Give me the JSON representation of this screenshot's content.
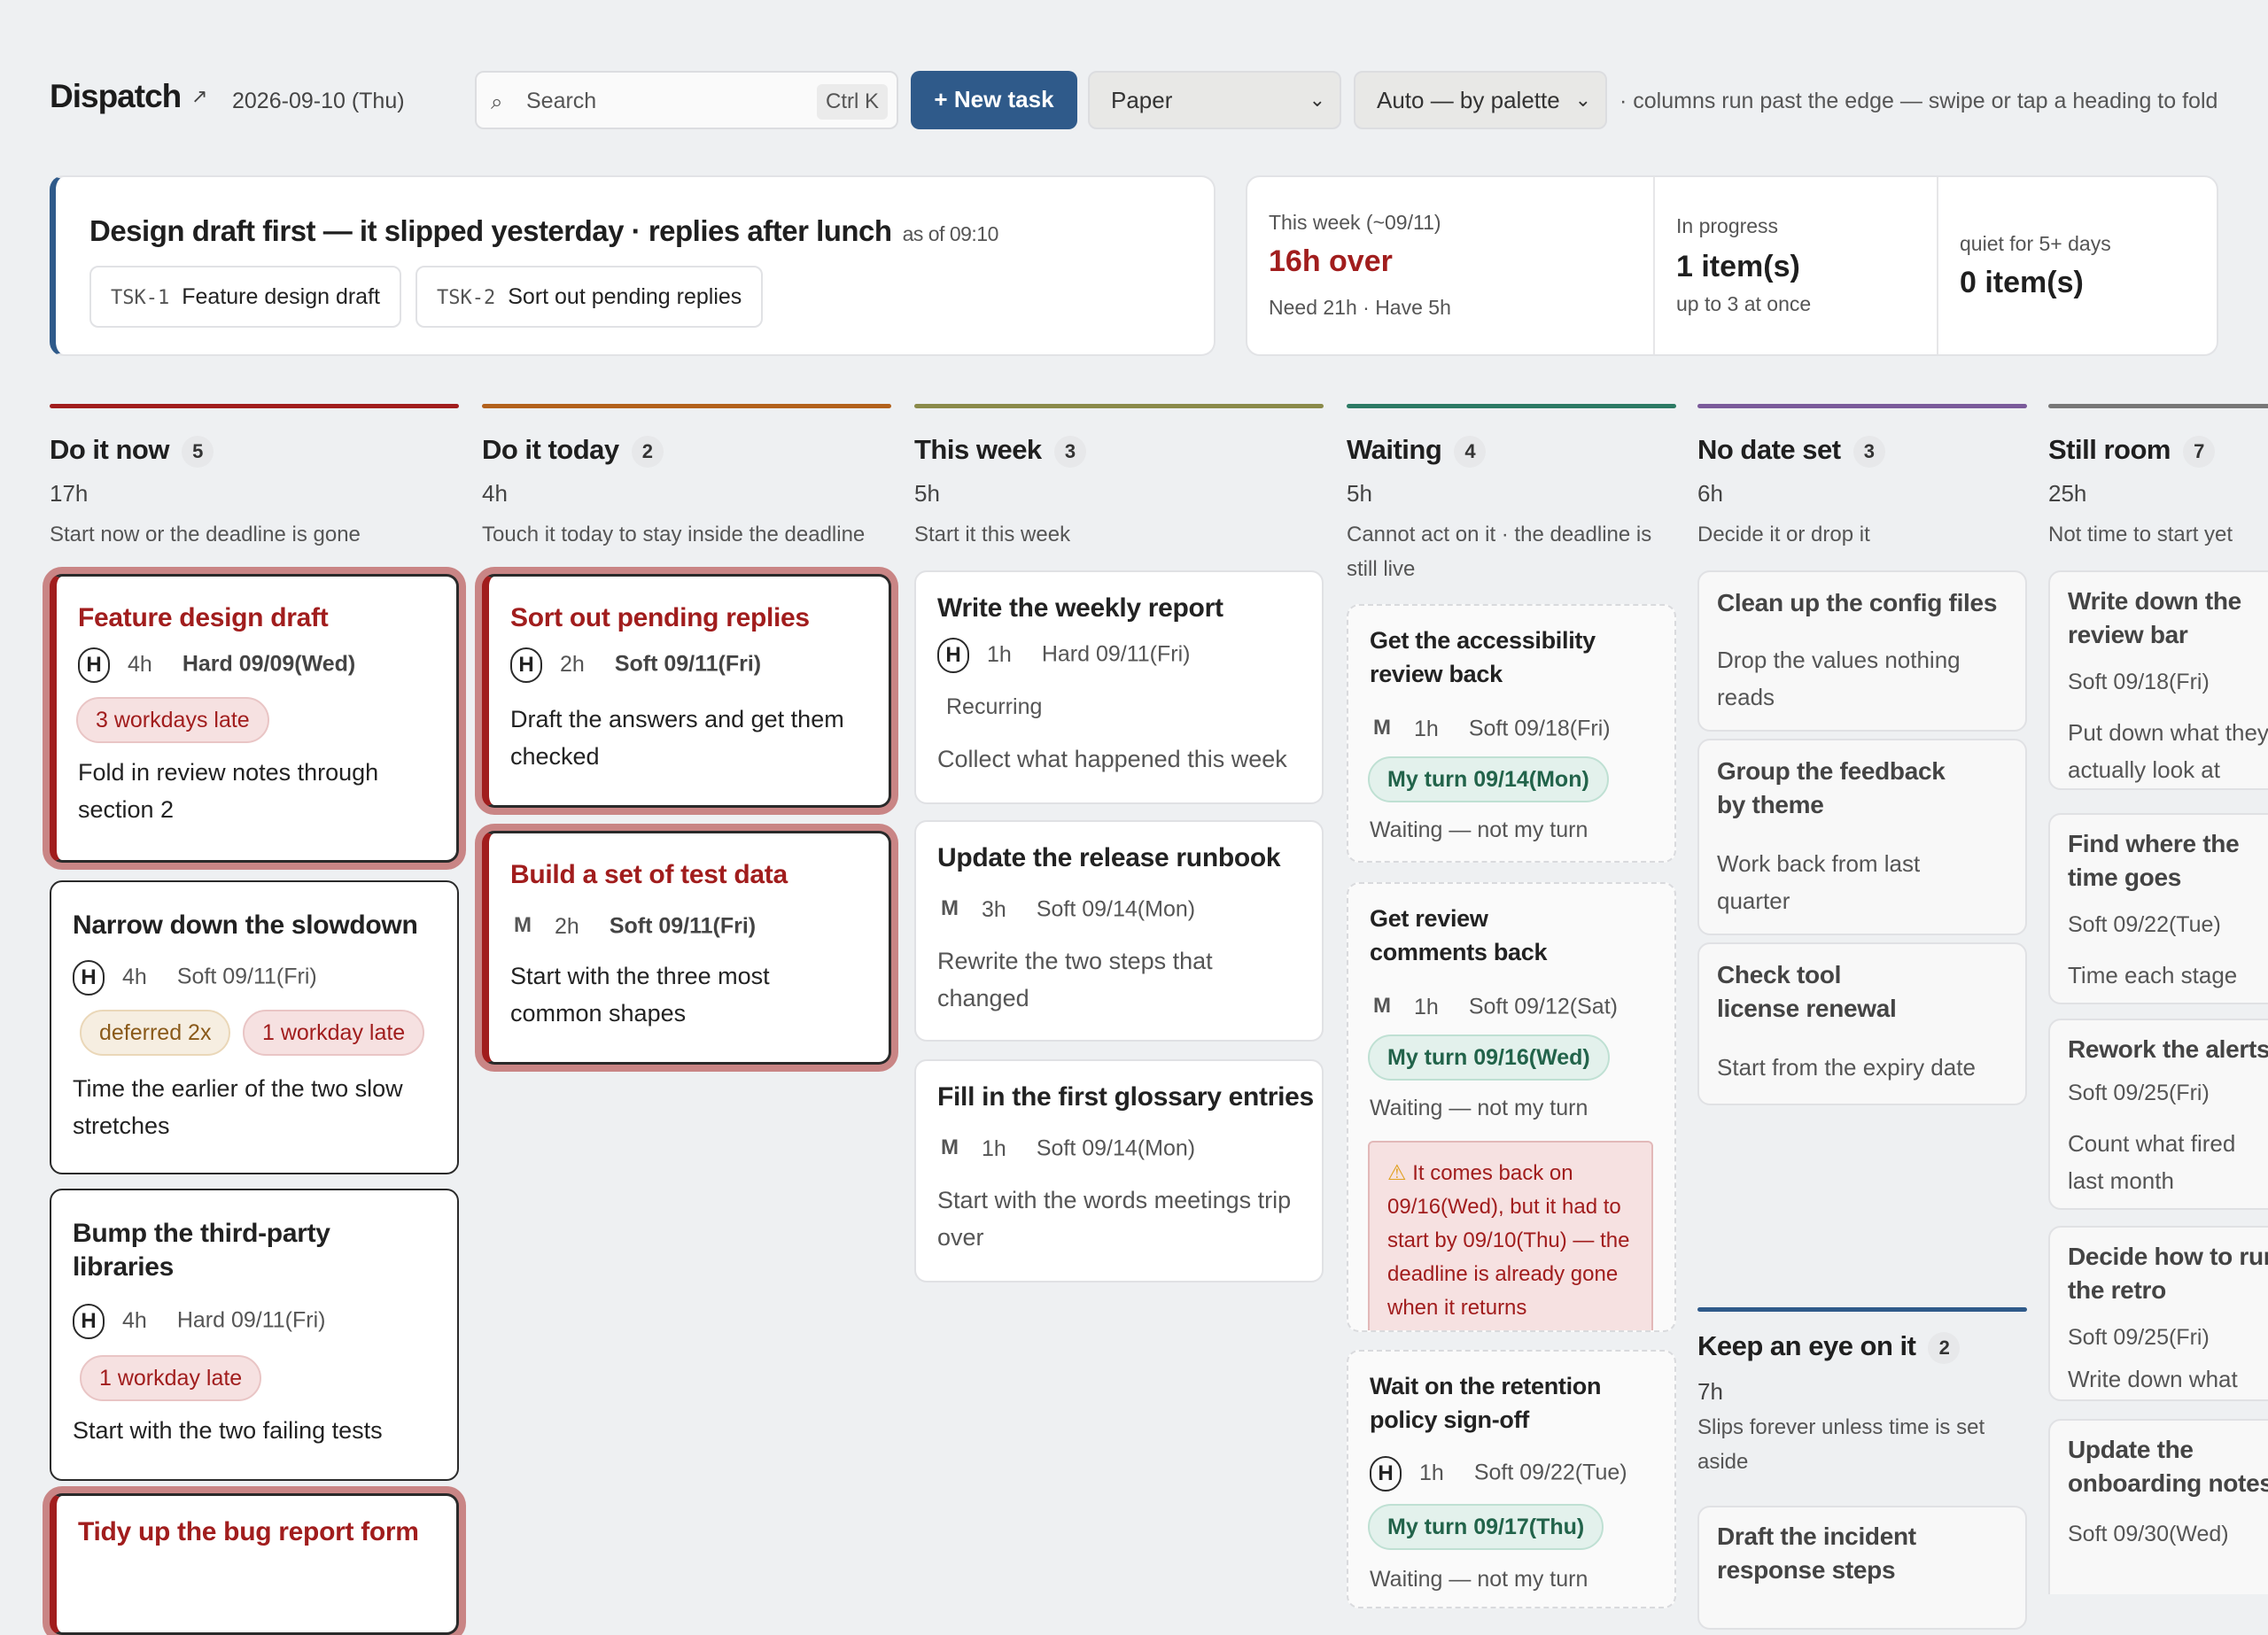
{
  "app": {
    "name": "Dispatch",
    "date": "2026-09-10 (Thu)"
  },
  "toolbar": {
    "search_placeholder": "Search",
    "search_shortcut": "Ctrl K",
    "new_task_label": "+ New task",
    "theme_selected": "Paper",
    "color_mode_selected": "Auto — by palette",
    "hint": "· columns run past the edge — swipe or tap a heading to fold"
  },
  "focus": {
    "title": "Design draft first — it slipped yesterday · replies after lunch",
    "as_of": "as of 09:10",
    "chips": [
      {
        "id": "TSK-1",
        "label": "Feature design draft"
      },
      {
        "id": "TSK-2",
        "label": "Sort out pending replies"
      }
    ]
  },
  "stats": [
    {
      "label": "This week (~09/11)",
      "value": "16h over",
      "sub": "Need 21h · Have 5h",
      "color": "#a11d1d"
    },
    {
      "label": "In progress",
      "value": "1 item(s)",
      "sub": "up to 3 at once"
    },
    {
      "label": "quiet for 5+ days",
      "value": "0 item(s)",
      "sub": ""
    }
  ],
  "columns": {
    "now": {
      "title": "Do it now",
      "count": "5",
      "hours": "17h",
      "desc": "Start now or the deadline is gone",
      "color": "#a11d1d",
      "cards": [
        {
          "title": "Feature design draft",
          "pri": "H",
          "hours": "4h",
          "deadline": "Hard 09/09(Wed)",
          "pills": [
            "3 workdays late"
          ],
          "note": "Fold in review notes through section 2"
        },
        {
          "title": "Narrow down the slowdown",
          "pri": "H",
          "hours": "4h",
          "deadline": "Soft 09/11(Fri)",
          "pills": [
            "deferred 2x",
            "1 workday late"
          ],
          "note": "Time the earlier of the two slow stretches"
        },
        {
          "title": "Bump the third-party libraries",
          "pri": "H",
          "hours": "4h",
          "deadline": "Hard 09/11(Fri)",
          "pills": [
            "1 workday late"
          ],
          "note": "Start with the two failing tests"
        },
        {
          "title": "Tidy up the bug report form",
          "pri": "",
          "hours": "",
          "deadline": "",
          "pills": [],
          "note": ""
        }
      ]
    },
    "today": {
      "title": "Do it today",
      "count": "2",
      "hours": "4h",
      "desc": "Touch it today to stay inside the deadline",
      "color": "#b2611c",
      "cards": [
        {
          "title": "Sort out pending replies",
          "pri": "H",
          "hours": "2h",
          "deadline": "Soft 09/11(Fri)",
          "note": "Draft the answers and get them checked"
        },
        {
          "title": "Build a set of test data",
          "pri": "M",
          "hours": "2h",
          "deadline": "Soft 09/11(Fri)",
          "note": "Start with the three most common shapes"
        }
      ]
    },
    "week": {
      "title": "This week",
      "count": "3",
      "hours": "5h",
      "desc": "Start it this week",
      "color": "#8a8a4a",
      "cards": [
        {
          "title": "Write the weekly report",
          "pri": "H",
          "hours": "1h",
          "deadline": "Hard 09/11(Fri)",
          "tag": "Recurring",
          "note": "Collect what happened this week"
        },
        {
          "title": "Update the release runbook",
          "pri": "M",
          "hours": "3h",
          "deadline": "Soft 09/14(Mon)",
          "note": "Rewrite the two steps that changed"
        },
        {
          "title": "Fill in the first glossary entries",
          "pri": "M",
          "hours": "1h",
          "deadline": "Soft 09/14(Mon)",
          "note": "Start with the words meetings trip over"
        }
      ]
    },
    "waiting": {
      "title": "Waiting",
      "count": "4",
      "hours": "5h",
      "desc": "Cannot act on it · the deadline is still live",
      "color": "#2c7a64",
      "cards": [
        {
          "title": "Get the accessibility review back",
          "pri": "M",
          "hours": "1h",
          "deadline": "Soft 09/18(Fri)",
          "turn": "My turn 09/14(Mon)",
          "note": "Waiting — not my turn"
        },
        {
          "title": "Get review comments back",
          "pri": "M",
          "hours": "1h",
          "deadline": "Soft 09/12(Sat)",
          "turn": "My turn 09/16(Wed)",
          "note": "Waiting — not my turn",
          "warning": "It comes back on 09/16(Wed), but it had to start by 09/10(Thu) — the deadline is already gone when it returns"
        },
        {
          "title": "Wait on the retention policy sign-off",
          "pri": "H",
          "hours": "1h",
          "deadline": "Soft 09/22(Tue)",
          "turn": "My turn 09/17(Thu)",
          "note": "Waiting — not my turn"
        }
      ]
    },
    "nodate": {
      "title": "No date set",
      "count": "3",
      "hours": "6h",
      "desc": "Decide it or drop it",
      "color": "#7a5a9a",
      "cards": [
        {
          "title": "Clean up the config files",
          "note": "Drop the values nothing reads"
        },
        {
          "title": "Group the feedback by theme",
          "note": "Work back from last quarter"
        },
        {
          "title": "Check tool license renewal",
          "note": "Start from the expiry date"
        }
      ]
    },
    "eye": {
      "title": "Keep an eye on it",
      "count": "2",
      "hours": "7h",
      "desc": "Slips forever unless time is set aside",
      "color": "#2f5a8a",
      "cards": [
        {
          "title": "Draft the incident response steps"
        }
      ]
    },
    "room": {
      "title": "Still room",
      "count": "7",
      "hours": "25h",
      "desc": "Not time to start yet",
      "color": "#777777",
      "cards": [
        {
          "title": "Write down the review bar",
          "deadline": "Soft 09/18(Fri)",
          "note": "Put down what they actually look at"
        },
        {
          "title": "Find where the time goes",
          "deadline": "Soft 09/22(Tue)",
          "note": "Time each stage"
        },
        {
          "title": "Rework the alerts",
          "deadline": "Soft 09/25(Fri)",
          "note": "Count what fired last month"
        },
        {
          "title": "Decide how to run the retro",
          "deadline": "Soft 09/25(Fri)",
          "note": "Write down what worked last time"
        },
        {
          "title": "Update the onboarding notes",
          "deadline": "Soft 09/30(Wed)",
          "note": ""
        }
      ]
    }
  }
}
